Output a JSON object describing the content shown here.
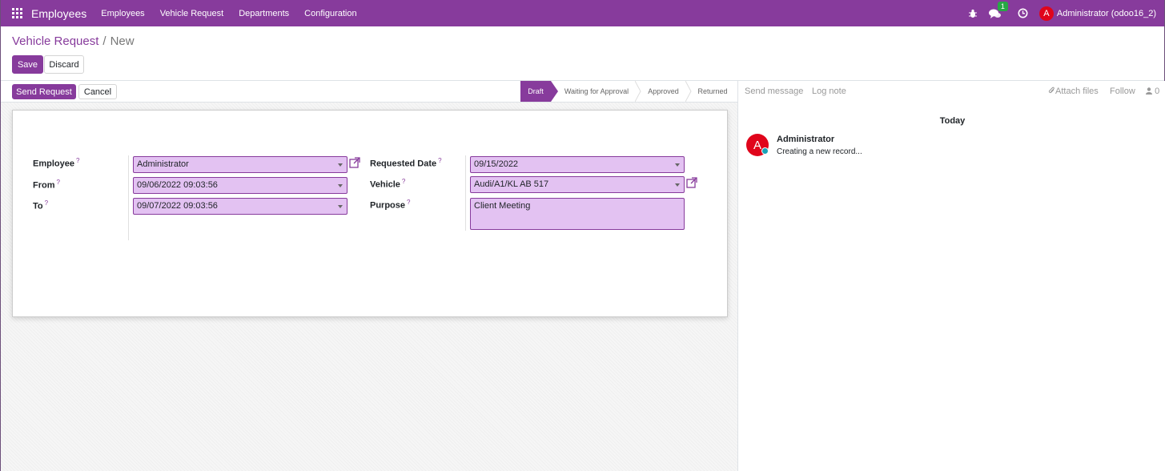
{
  "navbar": {
    "brand": "Employees",
    "menu": [
      "Employees",
      "Vehicle Request",
      "Departments",
      "Configuration"
    ],
    "chat_badge": "1",
    "avatar_letter": "A",
    "user": "Administrator (odoo16_2)"
  },
  "breadcrumb": {
    "parent": "Vehicle Request",
    "separator": "/",
    "current": "New"
  },
  "actions": {
    "save": "Save",
    "discard": "Discard"
  },
  "header_buttons": {
    "send_request": "Send Request",
    "cancel": "Cancel"
  },
  "stages": [
    {
      "label": "Draft",
      "active": true
    },
    {
      "label": "Waiting for Approval",
      "active": false
    },
    {
      "label": "Approved",
      "active": false
    },
    {
      "label": "Returned",
      "active": false
    }
  ],
  "form": {
    "employee_label": "Employee",
    "employee_value": "Administrator",
    "from_label": "From",
    "from_value": "09/06/2022 09:03:56",
    "to_label": "To",
    "to_value": "09/07/2022 09:03:56",
    "requested_date_label": "Requested Date",
    "requested_date_value": "09/15/2022",
    "vehicle_label": "Vehicle",
    "vehicle_value": "Audi/A1/KL AB 517",
    "purpose_label": "Purpose",
    "purpose_value": "Client Meeting",
    "help_mark": "?"
  },
  "chatter": {
    "send_message": "Send message",
    "log_note": "Log note",
    "attach_files": "Attach files",
    "follow": "Follow",
    "followers_count": "0",
    "date_separator": "Today",
    "message": {
      "avatar_letter": "A",
      "author": "Administrator",
      "body": "Creating a new record..."
    }
  },
  "colors": {
    "brand": "#873b9c",
    "field_bg": "#e3c2f2",
    "avatar": "#e0051b",
    "badge": "#28a745"
  }
}
